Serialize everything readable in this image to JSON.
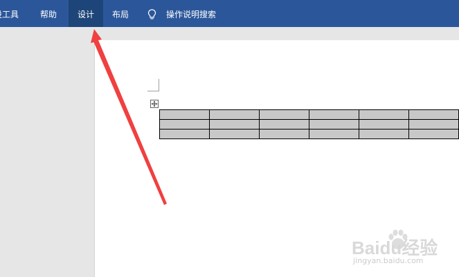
{
  "ribbon": {
    "tabs": [
      {
        "label": "设工具"
      },
      {
        "label": "帮助"
      },
      {
        "label": "设计"
      },
      {
        "label": "布局"
      }
    ],
    "tell_me": {
      "label": "操作说明搜索",
      "icon": "lightbulb-icon"
    },
    "background_color": "#2b579a",
    "active_tab_color": "#1e4579"
  },
  "document": {
    "table": {
      "rows": 3,
      "visible_columns": 6,
      "cell_shading": "#c8c8c8"
    }
  },
  "annotation": {
    "arrow_color": "#f04040"
  },
  "watermark": {
    "brand": "Baidu经验",
    "site": "jingyan.baidu.com"
  }
}
